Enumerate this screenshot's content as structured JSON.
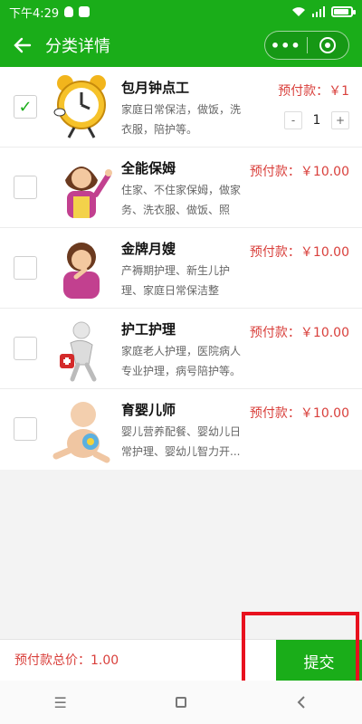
{
  "status_bar": {
    "time": "下午4:29"
  },
  "title_bar": {
    "title": "分类详情",
    "more_label": "•••"
  },
  "items": [
    {
      "title": "包月钟点工",
      "desc": "家庭日常保洁，做饭，洗衣服，陪护等。",
      "price": "预付款：￥1",
      "checked": true,
      "quantity": "1",
      "minus": "-",
      "plus": "+"
    },
    {
      "title": "全能保姆",
      "desc": "住家、不住家保姆，做家务、洗衣服、做饭、照顾...",
      "price": "预付款：￥10.00",
      "checked": false
    },
    {
      "title": "金牌月嫂",
      "desc": "产褥期护理、新生儿护理、家庭日常保洁整理、...",
      "price": "预付款：￥10.00",
      "checked": false
    },
    {
      "title": "护工护理",
      "desc": "家庭老人护理，医院病人专业护理，病号陪护等。",
      "price": "预付款：￥10.00",
      "checked": false
    },
    {
      "title": "育婴儿师",
      "desc": "婴儿营养配餐、婴幼儿日常护理、婴幼儿智力开...",
      "price": "预付款：￥10.00",
      "checked": false
    }
  ],
  "footer": {
    "total": "预付款总价：1.00",
    "submit": "提交"
  },
  "colors": {
    "primary": "#1aad19",
    "price": "#d9403c",
    "highlight": "#e8111e"
  },
  "icons": {
    "back": "arrow-left-icon",
    "more": "more-dots-icon",
    "close": "target-icon",
    "wifi": "wifi-icon",
    "signal": "signal-icon",
    "battery": "battery-icon"
  }
}
